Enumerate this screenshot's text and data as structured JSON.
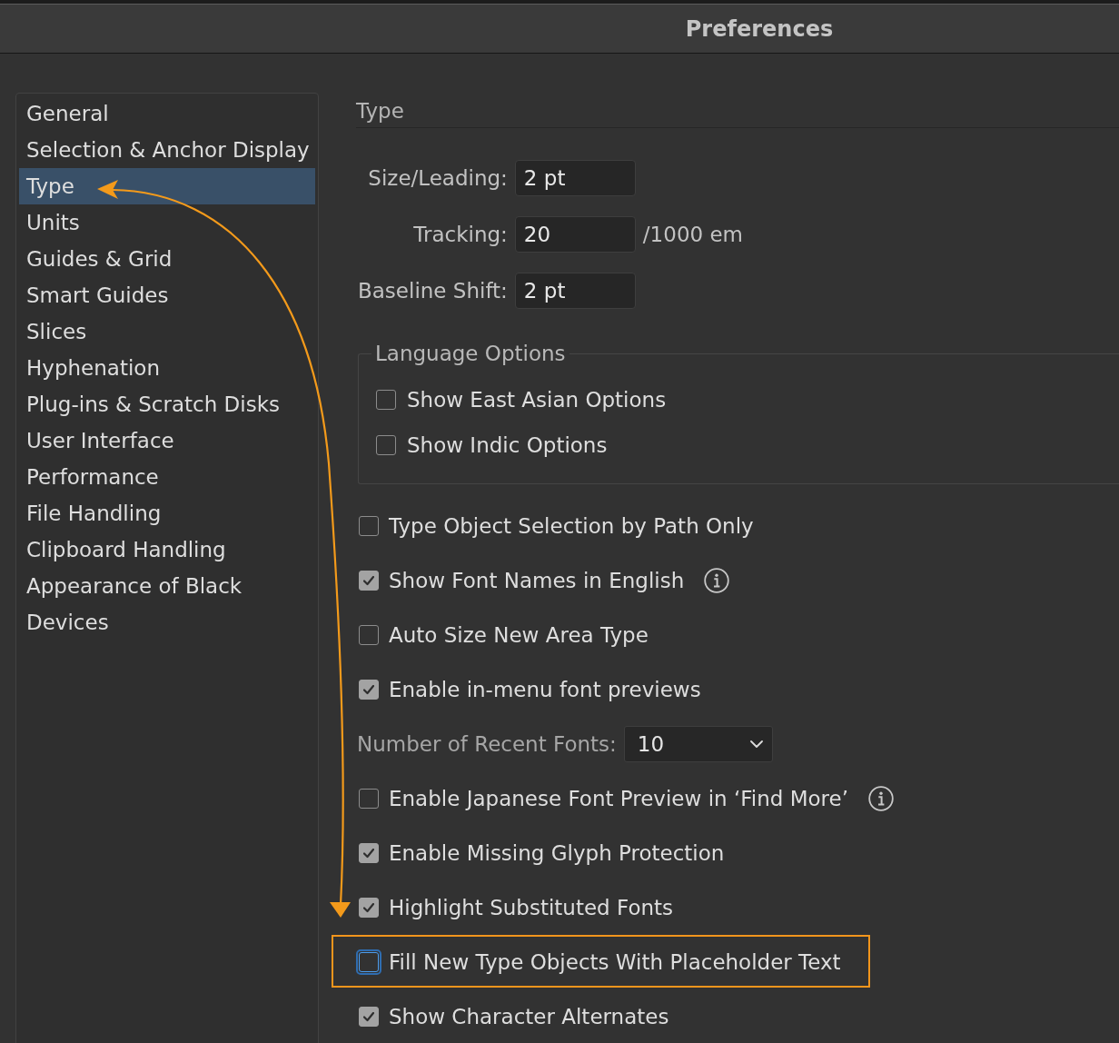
{
  "window": {
    "title": "Preferences"
  },
  "sidebar": {
    "items": [
      {
        "label": "General",
        "selected": false
      },
      {
        "label": "Selection & Anchor Display",
        "selected": false
      },
      {
        "label": "Type",
        "selected": true
      },
      {
        "label": "Units",
        "selected": false
      },
      {
        "label": "Guides & Grid",
        "selected": false
      },
      {
        "label": "Smart Guides",
        "selected": false
      },
      {
        "label": "Slices",
        "selected": false
      },
      {
        "label": "Hyphenation",
        "selected": false
      },
      {
        "label": "Plug-ins & Scratch Disks",
        "selected": false
      },
      {
        "label": "User Interface",
        "selected": false
      },
      {
        "label": "Performance",
        "selected": false
      },
      {
        "label": "File Handling",
        "selected": false
      },
      {
        "label": "Clipboard Handling",
        "selected": false
      },
      {
        "label": "Appearance of Black",
        "selected": false
      },
      {
        "label": "Devices",
        "selected": false
      }
    ]
  },
  "panel": {
    "heading": "Type",
    "fields": [
      {
        "label": "Size/Leading:",
        "value": "2 pt"
      },
      {
        "label": "Tracking:",
        "value": "20",
        "unit": "/1000 em"
      },
      {
        "label": "Baseline Shift:",
        "value": "2 pt"
      }
    ],
    "language_options": {
      "legend": "Language Options",
      "options": [
        {
          "label": "Show East Asian Options",
          "checked": false
        },
        {
          "label": "Show Indic Options",
          "checked": false
        }
      ]
    },
    "options": [
      {
        "kind": "checkbox",
        "label": "Type Object Selection by Path Only",
        "checked": false,
        "focused": false,
        "highlighted": false,
        "info": false
      },
      {
        "kind": "checkbox",
        "label": "Show Font Names in English",
        "checked": true,
        "focused": false,
        "highlighted": false,
        "info": true
      },
      {
        "kind": "checkbox",
        "label": "Auto Size New Area Type",
        "checked": false,
        "focused": false,
        "highlighted": false,
        "info": false
      },
      {
        "kind": "checkbox",
        "label": "Enable in-menu font previews",
        "checked": true,
        "focused": false,
        "highlighted": false,
        "info": false
      },
      {
        "kind": "dropdown",
        "label": "Number of Recent Fonts:",
        "value": "10"
      },
      {
        "kind": "checkbox",
        "label": "Enable Japanese Font Preview in ‘Find More’",
        "checked": false,
        "focused": false,
        "highlighted": false,
        "info": true
      },
      {
        "kind": "checkbox",
        "label": "Enable Missing Glyph Protection",
        "checked": true,
        "focused": false,
        "highlighted": false,
        "info": false
      },
      {
        "kind": "checkbox",
        "label": "Highlight Substituted Fonts",
        "checked": true,
        "focused": false,
        "highlighted": false,
        "info": false
      },
      {
        "kind": "checkbox",
        "label": "Fill New Type Objects With Placeholder Text",
        "checked": false,
        "focused": true,
        "highlighted": true,
        "info": false
      },
      {
        "kind": "checkbox",
        "label": "Show Character Alternates",
        "checked": true,
        "focused": false,
        "highlighted": false,
        "info": false
      }
    ]
  }
}
